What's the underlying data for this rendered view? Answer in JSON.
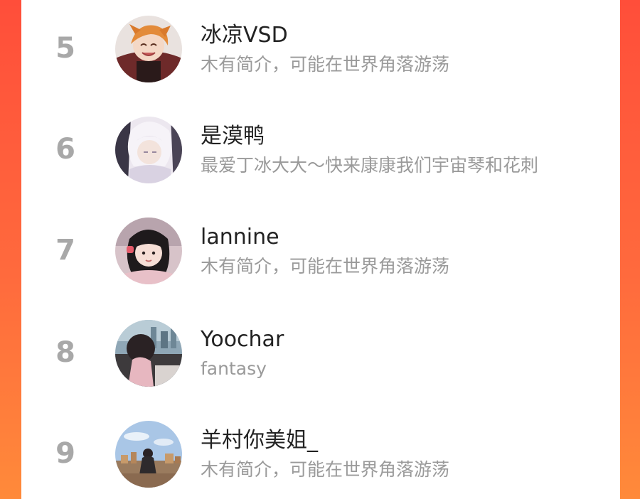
{
  "colors": {
    "background_gradient_top": "#ff4e3a",
    "background_gradient_bottom": "#ff8a3a",
    "card_background": "#ffffff",
    "rank_number": "#a8a8a8",
    "name_text": "#222222",
    "bio_text": "#9a9a9a"
  },
  "rankings": [
    {
      "rank": "5",
      "name": "冰凉VSD",
      "bio": "木有简介，可能在世界角落游荡",
      "avatar": "anime-boy-avatar"
    },
    {
      "rank": "6",
      "name": "是漠鸭",
      "bio": "最爱丁冰大大～快来康康我们宇宙琴和花刺",
      "avatar": "anime-white-hair-avatar"
    },
    {
      "rank": "7",
      "name": "lannine",
      "bio": "木有简介，可能在世界角落游荡",
      "avatar": "girl-selfie-avatar"
    },
    {
      "rank": "8",
      "name": "Yoochar",
      "bio": "fantasy",
      "avatar": "child-window-avatar"
    },
    {
      "rank": "9",
      "name": "羊村你美姐_",
      "bio": "木有简介，可能在世界角落游荡",
      "avatar": "city-view-avatar"
    }
  ]
}
